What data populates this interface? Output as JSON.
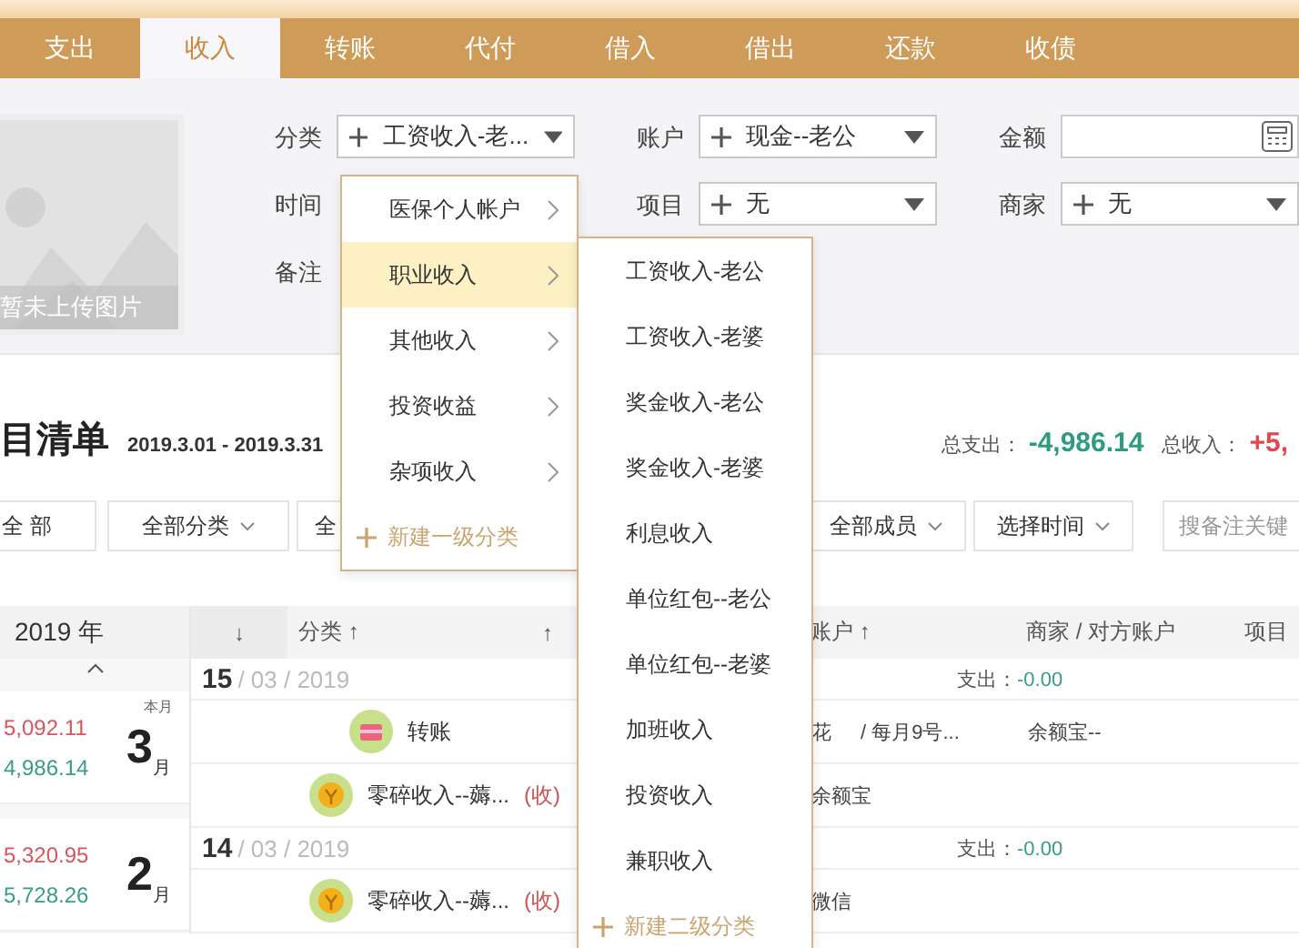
{
  "tabs": [
    {
      "label": "支出",
      "selected": false
    },
    {
      "label": "收入",
      "selected": true
    },
    {
      "label": "转账",
      "selected": false
    },
    {
      "label": "代付",
      "selected": false
    },
    {
      "label": "借入",
      "selected": false
    },
    {
      "label": "借出",
      "selected": false
    },
    {
      "label": "还款",
      "selected": false
    },
    {
      "label": "收债",
      "selected": false
    }
  ],
  "photo": {
    "caption": "暂未上传图片"
  },
  "form": [
    {
      "label": "分类",
      "kind": "select",
      "value": "工资收入-老..."
    },
    {
      "label": "账户",
      "kind": "select",
      "value": "现金--老公"
    },
    {
      "label": "金额",
      "kind": "amount"
    },
    {
      "label": "时间",
      "kind": "hidden"
    },
    {
      "label": "项目",
      "kind": "select",
      "value": "无"
    },
    {
      "label": "商家",
      "kind": "select",
      "value": "无"
    },
    {
      "label": "备注",
      "kind": "hidden"
    }
  ],
  "category_menu": {
    "items": [
      {
        "label": "医保个人帐户",
        "selected": false
      },
      {
        "label": "职业收入",
        "selected": true
      },
      {
        "label": "其他收入",
        "selected": false
      },
      {
        "label": "投资收益",
        "selected": false
      },
      {
        "label": "杂项收入",
        "selected": false
      }
    ],
    "new_item": "新建一级分类"
  },
  "subcategory_menu": {
    "items": [
      "工资收入-老公",
      "工资收入-老婆",
      "奖金收入-老公",
      "奖金收入-老婆",
      "利息收入",
      "单位红包--老公",
      "单位红包--老婆",
      "加班收入",
      "投资收入",
      "兼职收入"
    ],
    "new_item": "新建二级分类"
  },
  "list": {
    "title": "目清单",
    "date_range": "2019.3.01 - 2019.3.31",
    "totals": [
      {
        "label": "总支出：",
        "value": "-4,986.14",
        "kind": "expense"
      },
      {
        "label": "总收入：",
        "value": "+5,",
        "kind": "income"
      }
    ]
  },
  "filters_left": [
    {
      "label": "全 部",
      "dropdown": false
    },
    {
      "label": "全部分类",
      "dropdown": true
    },
    {
      "label": "全",
      "dropdown": false
    }
  ],
  "filters_right": [
    {
      "label": "全部成员",
      "dropdown": true
    },
    {
      "label": "选择时间",
      "dropdown": true
    }
  ],
  "search": {
    "placeholder": "搜备注关键"
  },
  "year_panel": {
    "year": "2019 年",
    "months": [
      {
        "income": "5,092.11",
        "expense": "4,986.14",
        "month": "3",
        "unit": "月",
        "badge": "本月"
      },
      {
        "income": "5,320.95",
        "expense": "5,728.26",
        "month": "2",
        "unit": "月"
      }
    ]
  },
  "table": {
    "columns": [
      "↓",
      "分类 ↑",
      "↑",
      "账户 ↑",
      "商家 / 对方账户",
      "项目"
    ],
    "groups": [
      {
        "day": "15",
        "date_rest": "/ 03 / 2019",
        "summary_label": "支出：",
        "summary_value": "-0.00",
        "rows": [
          {
            "kind": "transfer",
            "category": "转账",
            "account": "花",
            "account_note": "/ 每月9号...",
            "merchant": "余额宝--"
          },
          {
            "kind": "income",
            "category": "零碎收入--薅...",
            "tag": "(收)",
            "account": "余额宝"
          }
        ]
      },
      {
        "day": "14",
        "date_rest": "/ 03 / 2019",
        "summary_label": "支出：",
        "summary_value": "-0.00",
        "rows": [
          {
            "kind": "income",
            "category": "零碎收入--薅...",
            "tag": "(收)",
            "account": "微信"
          }
        ]
      }
    ]
  }
}
